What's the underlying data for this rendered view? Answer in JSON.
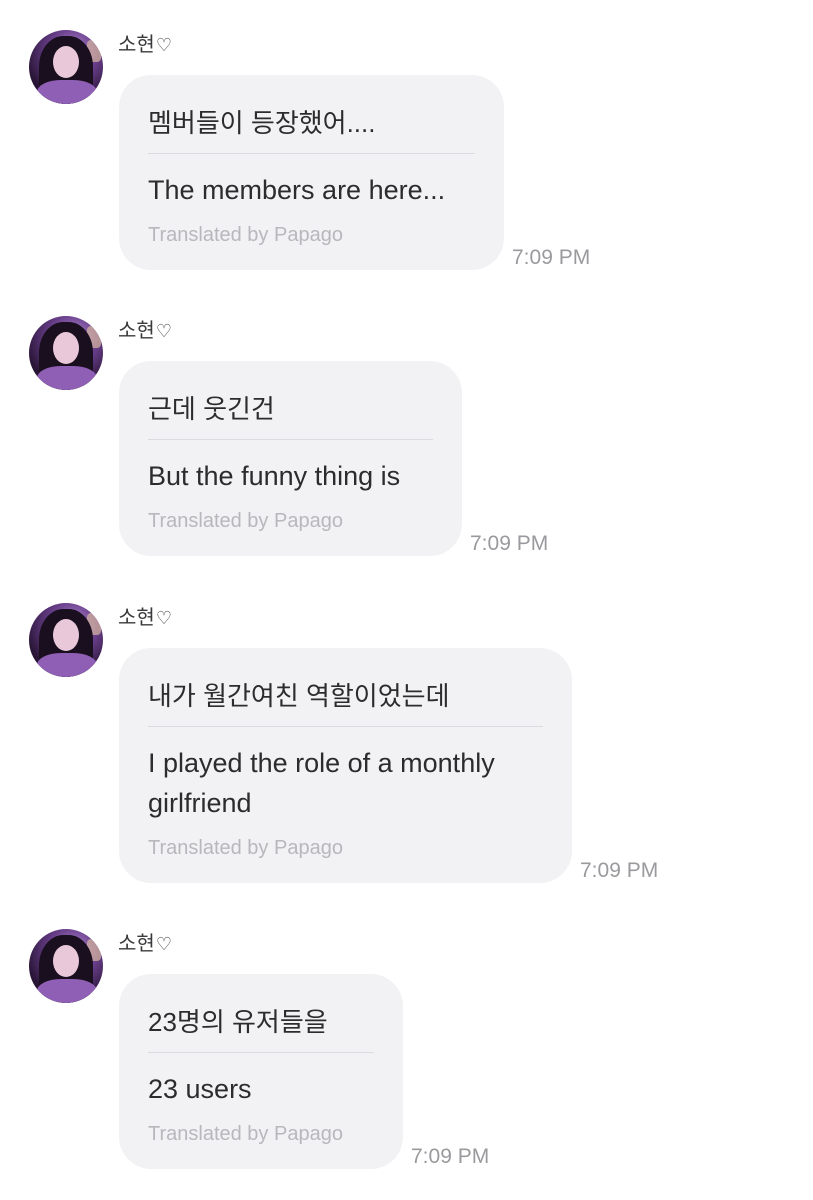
{
  "messages": [
    {
      "sender": "소현",
      "heart": "♡",
      "original": "멤버들이 등장했어....",
      "translated": "The members are here...",
      "credit": "Translated by Papago",
      "time": "7:09 PM"
    },
    {
      "sender": "소현",
      "heart": "♡",
      "original": "근데 웃긴건",
      "translated": "But the funny thing is",
      "credit": "Translated by Papago",
      "time": "7:09 PM"
    },
    {
      "sender": "소현",
      "heart": "♡",
      "original": "내가 월간여친 역할이었는데",
      "translated": "I played the role of a monthly girlfriend",
      "credit": "Translated by Papago",
      "time": "7:09 PM"
    },
    {
      "sender": "소현",
      "heart": "♡",
      "original": "23명의 유저들을",
      "translated": "23 users",
      "credit": "Translated by Papago",
      "time": "7:09 PM"
    }
  ],
  "colors": {
    "bubble": "#f2f2f4",
    "text": "#2c2c2e",
    "credit": "#b8b8bc",
    "time": "#9a9a9e",
    "avatar_accent": "#8e5fb5"
  }
}
